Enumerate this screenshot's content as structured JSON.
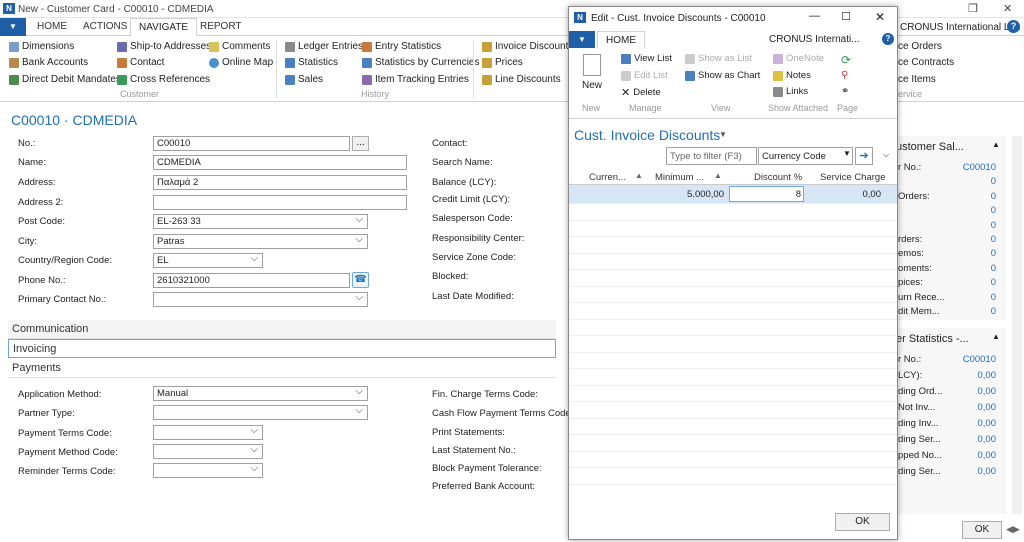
{
  "window": {
    "title": "New - Customer Card - C00010 - CDMEDIA",
    "company": "CRONUS International Ltd."
  },
  "ribbon_tabs": [
    "HOME",
    "ACTIONS",
    "NAVIGATE",
    "REPORT"
  ],
  "ribbon": {
    "customer": {
      "group": "Customer",
      "items": [
        "Dimensions",
        "Bank Accounts",
        "Direct Debit Mandates",
        "Ship-to Addresses",
        "Contact",
        "Cross References",
        "Comments",
        "Online Map"
      ]
    },
    "history": {
      "group": "History",
      "items": [
        "Ledger Entries",
        "Statistics",
        "Sales",
        "Entry Statistics",
        "Statistics by Currencies",
        "Item Tracking Entries"
      ]
    },
    "prices": {
      "items": [
        "Invoice Discounts",
        "Prices",
        "Line Discounts"
      ]
    },
    "right_items": [
      "ce Orders",
      "ce Contracts",
      "ce Items"
    ],
    "right_group": "ervice"
  },
  "page_title": "C00010 · CDMEDIA",
  "general": {
    "left": [
      {
        "label": "No.:",
        "value": "C00010"
      },
      {
        "label": "Name:",
        "value": "CDMEDIA"
      },
      {
        "label": "Address:",
        "value": "Παλαμά 2"
      },
      {
        "label": "Address 2:",
        "value": ""
      },
      {
        "label": "Post Code:",
        "value": "EL-263 33"
      },
      {
        "label": "City:",
        "value": "Patras"
      },
      {
        "label": "Country/Region Code:",
        "value": "EL"
      },
      {
        "label": "Phone No.:",
        "value": "2610321000"
      },
      {
        "label": "Primary Contact No.:",
        "value": ""
      }
    ],
    "right_labels": [
      "Contact:",
      "Search Name:",
      "Balance (LCY):",
      "Credit Limit (LCY):",
      "Salesperson Code:",
      "Responsibility Center:",
      "Service Zone Code:",
      "Blocked:",
      "Last Date Modified:"
    ]
  },
  "fasttabs": [
    "Communication",
    "Invoicing",
    "Payments"
  ],
  "payments": {
    "left": [
      {
        "label": "Application Method:",
        "value": "Manual"
      },
      {
        "label": "Partner Type:",
        "value": ""
      },
      {
        "label": "Payment Terms Code:",
        "value": ""
      },
      {
        "label": "Payment Method Code:",
        "value": ""
      },
      {
        "label": "Reminder Terms Code:",
        "value": ""
      }
    ],
    "right_labels": [
      "Fin. Charge Terms Code:",
      "Cash Flow Payment Terms Code:",
      "Print Statements:",
      "Last Statement No.:",
      "Block Payment Tolerance:",
      "Preferred Bank Account:"
    ]
  },
  "factbox1": {
    "title": "ustomer Sal...",
    "rows": [
      {
        "label": "r No.:",
        "value": "C00010"
      },
      {
        "label": "",
        "value": "0"
      },
      {
        "label": "Orders:",
        "value": "0"
      },
      {
        "label": "",
        "value": "0"
      },
      {
        "label": "",
        "value": "0"
      },
      {
        "label": "rders:",
        "value": "0"
      },
      {
        "label": "emos:",
        "value": "0"
      },
      {
        "label": "oments:",
        "value": "0"
      },
      {
        "label": "pices:",
        "value": "0"
      },
      {
        "label": "urn Rece...",
        "value": "0"
      },
      {
        "label": "dit Mem...",
        "value": "0"
      }
    ]
  },
  "factbox2": {
    "title": "er Statistics -...",
    "rows": [
      {
        "label": "r No.:",
        "value": "C00010"
      },
      {
        "label": "LCY):",
        "value": "0,00"
      },
      {
        "label": "ding Ord...",
        "value": "0,00"
      },
      {
        "label": "Not Inv...",
        "value": "0,00"
      },
      {
        "label": "ding Inv...",
        "value": "0,00"
      },
      {
        "label": "ding Ser...",
        "value": "0,00"
      },
      {
        "label": "pped No...",
        "value": "0,00"
      },
      {
        "label": "ding Ser...",
        "value": "0,00"
      }
    ]
  },
  "ok_label": "OK",
  "modal": {
    "title": "Edit - Cust. Invoice Discounts - C00010",
    "tab": "HOME",
    "company": "CRONUS Internati...",
    "actions": {
      "new": "New",
      "view_list": "View List",
      "edit_list": "Edit List",
      "delete": "Delete",
      "show_as_list": "Show as List",
      "show_as_chart": "Show as Chart",
      "onenote": "OneNote",
      "notes": "Notes",
      "links": "Links"
    },
    "groups": [
      "New",
      "Manage",
      "View",
      "Show Attached",
      "Page"
    ],
    "list_title": "Cust. Invoice Discounts",
    "filter_placeholder": "Type to filter (F3)",
    "filter_field": "Currency Code",
    "columns": [
      "Curren...",
      "Minimum ...",
      "Discount %",
      "Service Charge"
    ],
    "row": {
      "currency": "",
      "minimum": "5.000,00",
      "discount": "8",
      "service_charge": "0,00"
    },
    "ok": "OK"
  }
}
